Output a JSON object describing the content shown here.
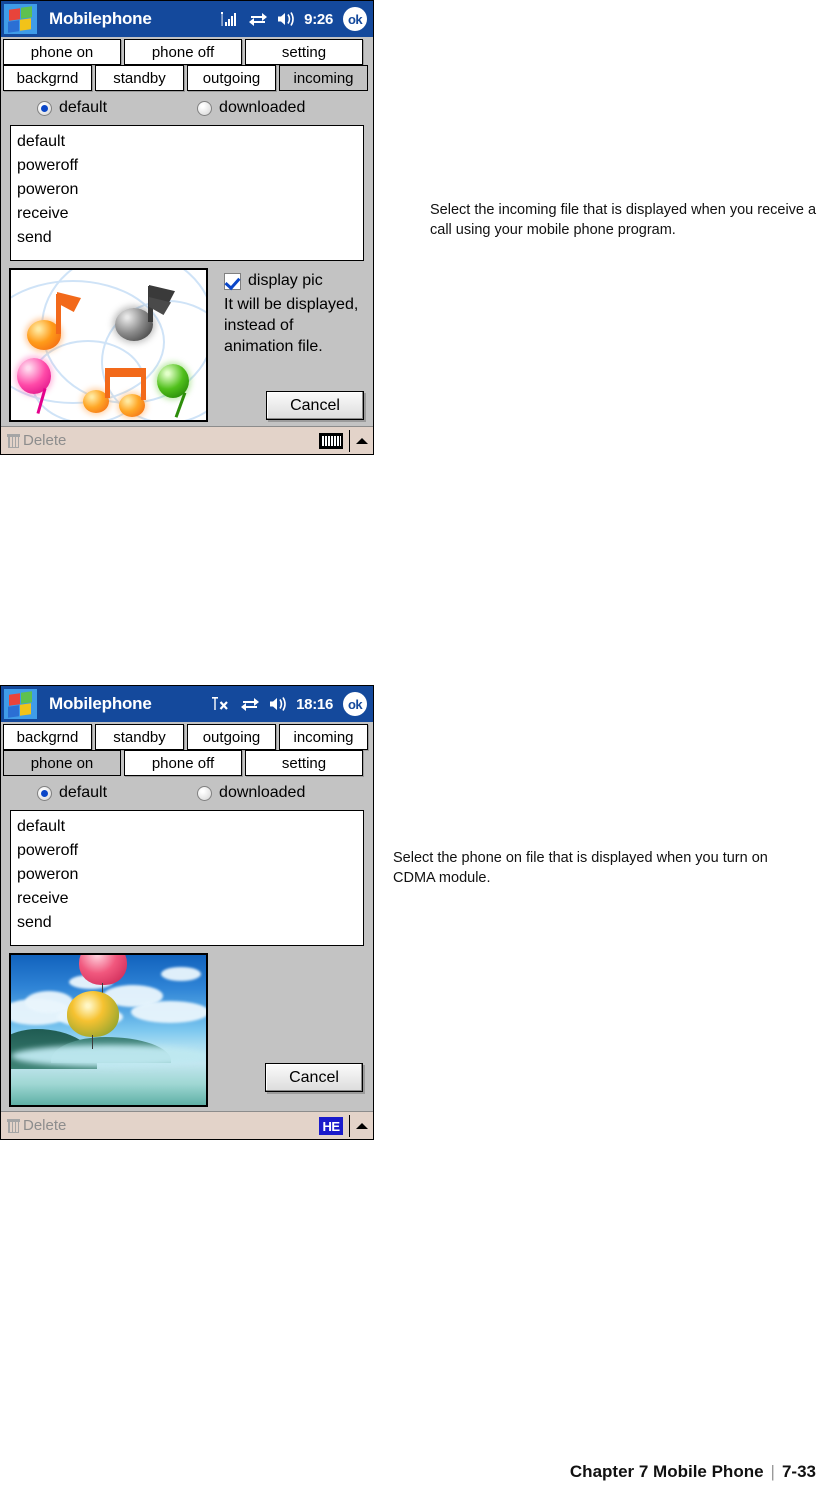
{
  "page": {
    "footer_chapter": "Chapter 7 Mobile Phone",
    "footer_separator": "|",
    "footer_page": "7-33"
  },
  "screens": [
    {
      "id": "incoming",
      "titlebar": {
        "app_title": "Mobilephone",
        "signal_icon": "signal-bars-icon",
        "connection_icon": "connectivity-icon",
        "volume_icon": "speaker-icon",
        "time": "9:26",
        "ok_label": "ok"
      },
      "tabs_row_top": [
        {
          "label": "phone on",
          "selected": false
        },
        {
          "label": "phone off",
          "selected": false
        },
        {
          "label": "setting",
          "selected": false
        }
      ],
      "tabs_row_bottom": [
        {
          "label": "backgrnd",
          "selected": false
        },
        {
          "label": "standby",
          "selected": false
        },
        {
          "label": "outgoing",
          "selected": false
        },
        {
          "label": "incoming",
          "selected": true
        }
      ],
      "radios": [
        {
          "label": "default",
          "checked": true
        },
        {
          "label": "downloaded",
          "checked": false
        }
      ],
      "list_items": [
        "default",
        "poweroff",
        "poweron",
        "receive",
        "send"
      ],
      "preview_art": "music-notes",
      "checkbox": {
        "label": "display pic",
        "checked": true
      },
      "hint_text": "It will be displayed, instead of animation file.",
      "cancel_label": "Cancel",
      "statusbar": {
        "delete_label": "Delete",
        "input_icon": "keyboard-icon",
        "input_label": ""
      }
    },
    {
      "id": "phone-on",
      "titlebar": {
        "app_title": "Mobilephone",
        "signal_icon": "no-signal-icon",
        "connection_icon": "connectivity-icon",
        "volume_icon": "speaker-icon",
        "time": "18:16",
        "ok_label": "ok"
      },
      "tabs_row_top": [
        {
          "label": "backgrnd",
          "selected": false
        },
        {
          "label": "standby",
          "selected": false
        },
        {
          "label": "outgoing",
          "selected": false
        },
        {
          "label": "incoming",
          "selected": false
        }
      ],
      "tabs_row_bottom": [
        {
          "label": "phone on",
          "selected": true
        },
        {
          "label": "phone off",
          "selected": false
        },
        {
          "label": "setting",
          "selected": false
        }
      ],
      "radios": [
        {
          "label": "default",
          "checked": true
        },
        {
          "label": "downloaded",
          "checked": false
        }
      ],
      "list_items": [
        "default",
        "poweroff",
        "poweron",
        "receive",
        "send"
      ],
      "preview_art": "sky-balloons",
      "cancel_label": "Cancel",
      "statusbar": {
        "delete_label": "Delete",
        "input_icon": "he-input-icon",
        "input_label": "HE"
      }
    }
  ],
  "descriptions": {
    "first": "Select the incoming file that is displayed when you receive a call using your mobile phone program.",
    "second": "Select the phone on file that is displayed when you turn on CDMA module."
  },
  "colors": {
    "titlebar_blue": "#14499c",
    "window_gray": "#c3c3c3",
    "statusbar_beige": "#e3d3c9",
    "radio_blue": "#0a46c8",
    "he_badge_blue": "#1a1acb"
  }
}
